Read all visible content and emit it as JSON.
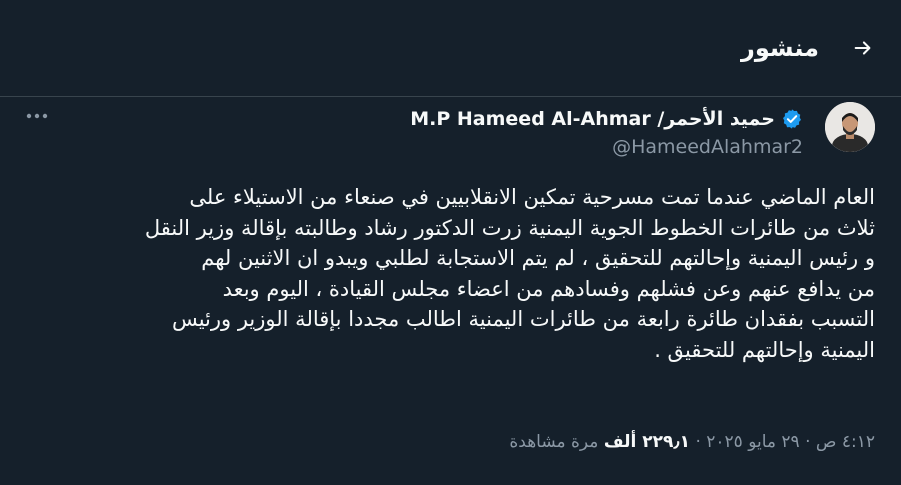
{
  "header": {
    "title": "منشور",
    "back_icon": "arrow-back-icon"
  },
  "author": {
    "display_name": "M.P Hameed Al-Ahmar /حميد الأحمر",
    "handle": "@HameedAlahmar2",
    "verified": true,
    "verified_color": "#1d9bf0"
  },
  "more_icon": "more-dots-icon",
  "tweet": {
    "lines": [
      "العام الماضي عندما تمت مسرحية تمكين الانقلابيين في صنعاء من الاستيلاء على",
      "ثلاث من طائرات الخطوط الجوية اليمنية زرت الدكتور رشاد وطالبته بإقالة وزير النقل",
      "و رئيس اليمنية وإحالتهم للتحقيق ، لم يتم الاستجابة لطلبي ويبدو ان الاثنين لهم",
      "من يدافع عنهم وعن فشلهم وفسادهم من اعضاء مجلس القيادة ، اليوم وبعد",
      "التسبب بفقدان طائرة رابعة من طائرات اليمنية اطالب مجددا بإقالة الوزير ورئيس",
      "اليمنية وإحالتهم للتحقيق ."
    ]
  },
  "meta": {
    "time": "٤:١٢ ص",
    "separator": "·",
    "date": "٢٩ مايو ٢٠٢٥",
    "views_count": "٢٢٩٫١ ألف",
    "views_label": "مرة مشاهدة"
  },
  "colors": {
    "background": "#15202b",
    "text": "#f7f9f9",
    "secondary": "#8b98a5",
    "border": "#38444d"
  }
}
